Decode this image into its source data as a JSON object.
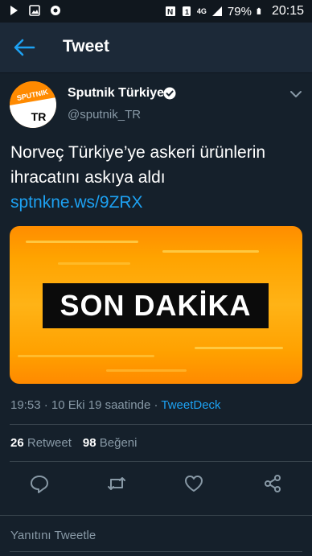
{
  "status_bar": {
    "battery_percent": "79%",
    "time": "20:15",
    "network_label": "4G"
  },
  "app_bar": {
    "title": "Tweet"
  },
  "tweet": {
    "author_name": "Sputnik Türkiye",
    "author_handle": "@sputnik_TR",
    "avatar_text_top": "SPUTNIK",
    "avatar_text_bottom": "TR",
    "text": "Norveç Türkiye’ye askeri ürünlerin ihracatını askıya aldı",
    "link": "sptnkne.ws/9ZRX",
    "media_caption": "SON DAKİKA",
    "timestamp": "19:53 · 10 Eki 19 saatinde · ",
    "source": "TweetDeck",
    "retweet_count": "26",
    "retweet_label": "Retweet",
    "like_count": "98",
    "like_label": "Beğeni"
  },
  "reply": {
    "placeholder": "Yanıtını Tweetle"
  },
  "colors": {
    "background": "#15202b",
    "accent": "#1da1f2",
    "secondary_text": "#8899a6"
  },
  "icons": [
    "image-icon",
    "chrome-icon",
    "nfc-icon",
    "sim-icon",
    "signal-icon",
    "battery-icon",
    "back-arrow-icon",
    "verified-icon",
    "chevron-down-icon",
    "reply-icon",
    "retweet-icon",
    "like-icon",
    "share-icon"
  ]
}
